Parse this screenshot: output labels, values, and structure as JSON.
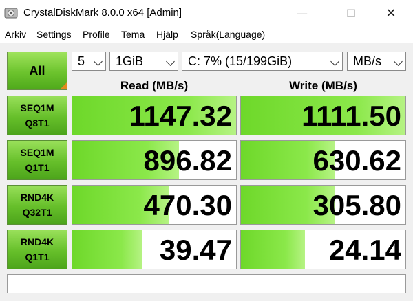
{
  "window": {
    "title": "CrystalDiskMark 8.0.0 x64 [Admin]"
  },
  "menu": [
    "Arkiv",
    "Settings",
    "Profile",
    "Tema",
    "Hjälp",
    "Språk(Language)"
  ],
  "controls": {
    "all_label": "All",
    "count": "5",
    "size": "1GiB",
    "drive": "C: 7% (15/199GiB)",
    "unit": "MB/s"
  },
  "headers": {
    "read": "Read (MB/s)",
    "write": "Write (MB/s)"
  },
  "tests": [
    {
      "line1": "SEQ1M",
      "line2": "Q8T1",
      "read": "1147.32",
      "write": "1111.50",
      "read_fill": 1.0,
      "write_fill": 1.0
    },
    {
      "line1": "SEQ1M",
      "line2": "Q1T1",
      "read": "896.82",
      "write": "630.62",
      "read_fill": 0.65,
      "write_fill": 0.57
    },
    {
      "line1": "RND4K",
      "line2": "Q32T1",
      "read": "470.30",
      "write": "305.80",
      "read_fill": 0.59,
      "write_fill": 0.57
    },
    {
      "line1": "RND4K",
      "line2": "Q1T1",
      "read": "39.47",
      "write": "24.14",
      "read_fill": 0.43,
      "write_fill": 0.39
    }
  ],
  "status": "",
  "colors": {
    "accent_green": "#6cc32d",
    "corner_orange": "#e08a1e"
  },
  "icons": {
    "app": "disk-icon",
    "minimize": "minimize-icon",
    "maximize": "maximize-icon",
    "close": "close-icon",
    "dropdown": "chevron-down-icon"
  }
}
